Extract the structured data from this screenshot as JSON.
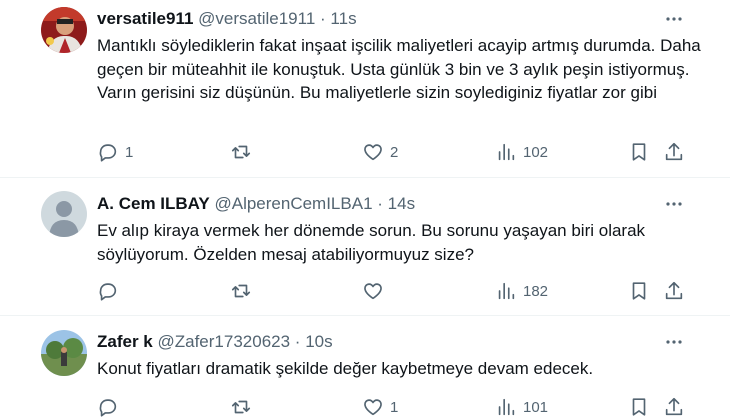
{
  "tweets": [
    {
      "name": "versatile911",
      "handle": "@versatile1911",
      "sep": "·",
      "time": "11s",
      "text": "Mantıklı söylediklerin fakat inşaat işcilik maliyetleri acayip artmış durumda. Daha geçen bir müteahhit ile konuştuk. Usta günlük 3 bin ve 3 aylık peşin istiyormuş. Varın gerisini siz düşünün. Bu maliyetlerle sizin soylediginiz fiyatlar zor gibi",
      "replies": "1",
      "retweets": "",
      "likes": "2",
      "views": "102",
      "avatar_icon": "profile-photo-red"
    },
    {
      "name": "A. Cem ILBAY",
      "handle": "@AlperenCemILBA1",
      "sep": "·",
      "time": "14s",
      "text": "Ev alıp kiraya vermek her dönemde  sorun. Bu sorunu yaşayan biri olarak söylüyorum. Özelden mesaj atabiliyormuyuz size?",
      "replies": "",
      "retweets": "",
      "likes": "",
      "views": "182",
      "avatar_icon": "default-profile-silhouette"
    },
    {
      "name": "Zafer k",
      "handle": "@Zafer17320623",
      "sep": "·",
      "time": "10s",
      "text": "Konut fiyatları dramatik şekilde değer kaybetmeye devam edecek.",
      "replies": "",
      "retweets": "",
      "likes": "1",
      "views": "101",
      "avatar_icon": "profile-photo-landscape"
    }
  ],
  "colors": {
    "text": "#0f1419",
    "secondary": "#536471",
    "divider": "#eff3f4",
    "background": "#ffffff"
  }
}
